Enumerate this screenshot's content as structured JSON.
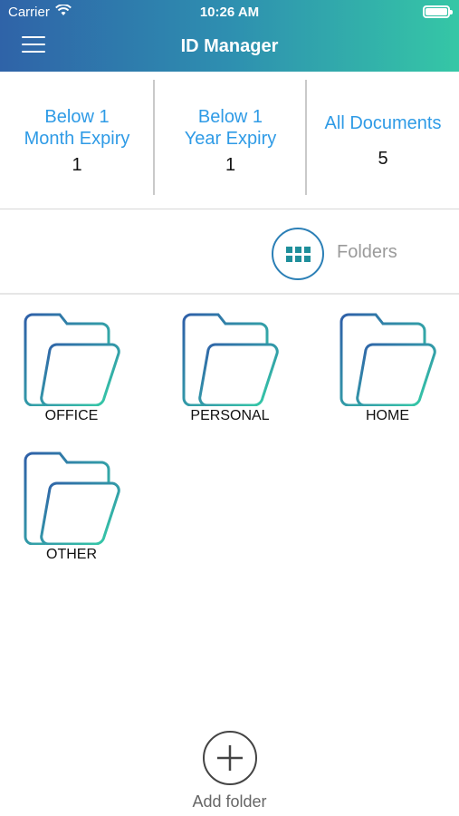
{
  "status_bar": {
    "carrier": "Carrier",
    "time": "10:26 AM",
    "icons": [
      "wifi-icon",
      "battery-icon"
    ]
  },
  "header": {
    "title": "ID Manager",
    "menu_icon": "menu-icon"
  },
  "stats": [
    {
      "label_line1": "Below 1",
      "label_line2": "Month Expiry",
      "value": "1"
    },
    {
      "label_line1": "Below 1",
      "label_line2": "Year Expiry",
      "value": "1"
    },
    {
      "label_line1": "All Documents",
      "label_line2": "",
      "value": "5"
    }
  ],
  "view_toggle": {
    "label": "Folders",
    "icon": "grid-icon"
  },
  "folders": [
    {
      "name": "OFFICE",
      "icon": "folder-icon"
    },
    {
      "name": "PERSONAL",
      "icon": "folder-icon"
    },
    {
      "name": "HOME",
      "icon": "folder-icon"
    },
    {
      "name": "OTHER",
      "icon": "folder-icon"
    }
  ],
  "add_folder": {
    "label": "Add folder",
    "icon": "plus-icon"
  },
  "colors": {
    "header_start": "#2f63a8",
    "header_end": "#35c7a6",
    "accent_blue": "#2f9be6",
    "folder_stroke_start": "#2f63a8",
    "folder_stroke_end": "#35d0a8"
  }
}
